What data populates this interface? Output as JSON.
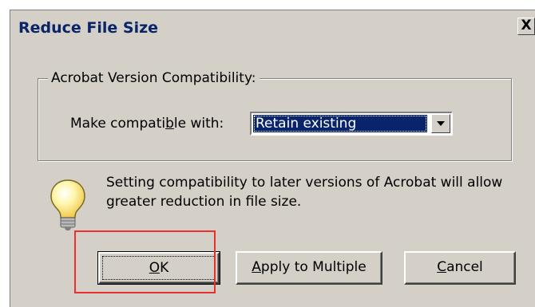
{
  "window": {
    "title": "Reduce File Size",
    "close_label": "X"
  },
  "compatibility": {
    "group_title": "Acrobat Version Compatibility:",
    "label_prefix": "Make compati",
    "label_mnemonic": "b",
    "label_suffix": "le with:",
    "selected_value": "Retain existing"
  },
  "info": {
    "icon": "lightbulb-icon",
    "text": "Setting compatibility to later versions of Acrobat will allow greater reduction in file size."
  },
  "buttons": {
    "ok": {
      "mnemonic": "O",
      "rest": "K"
    },
    "apply": {
      "mnemonic": "A",
      "rest": "pply to Multiple"
    },
    "cancel": {
      "mnemonic": "C",
      "rest": "ancel"
    }
  },
  "annotation": {
    "highlight_color": "#e8312f",
    "highlighted": "ok-button"
  },
  "colors": {
    "dialog_bg": "#d4d0c8",
    "selection_bg": "#0a246a",
    "title_text": "#0a246a"
  }
}
